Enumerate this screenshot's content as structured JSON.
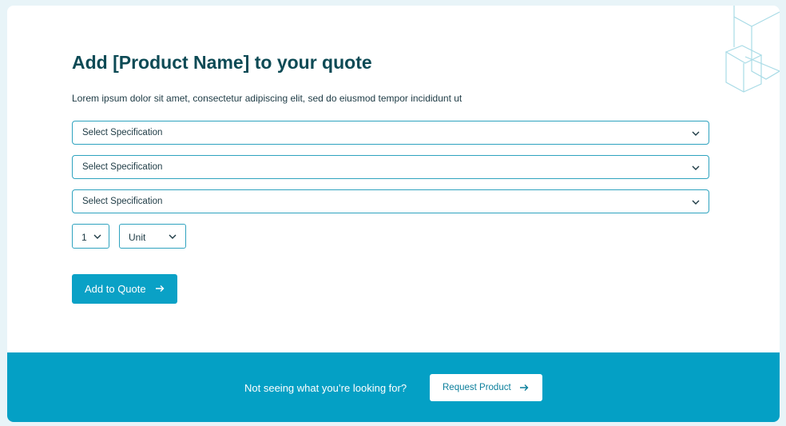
{
  "quote_form": {
    "title": "Add [Product Name] to your quote",
    "description": "Lorem ipsum dolor sit amet, consectetur adipiscing elit, sed do eiusmod tempor incididunt ut",
    "specifications": [
      {
        "placeholder": "Select Specification"
      },
      {
        "placeholder": "Select Specification"
      },
      {
        "placeholder": "Select Specification"
      }
    ],
    "quantity": {
      "value": "1"
    },
    "unit": {
      "value": "Unit"
    },
    "add_button": {
      "label": "Add to Quote",
      "icon": "arrow-right-icon"
    }
  },
  "footer": {
    "question": "Not seeing what you’re looking for?",
    "request_button": {
      "label": "Request Product",
      "icon": "arrow-right-icon"
    }
  },
  "colors": {
    "accent": "#04a0c5",
    "title": "#0d4a55",
    "border": "#2fa3bf",
    "background": "#e8f4f8"
  }
}
